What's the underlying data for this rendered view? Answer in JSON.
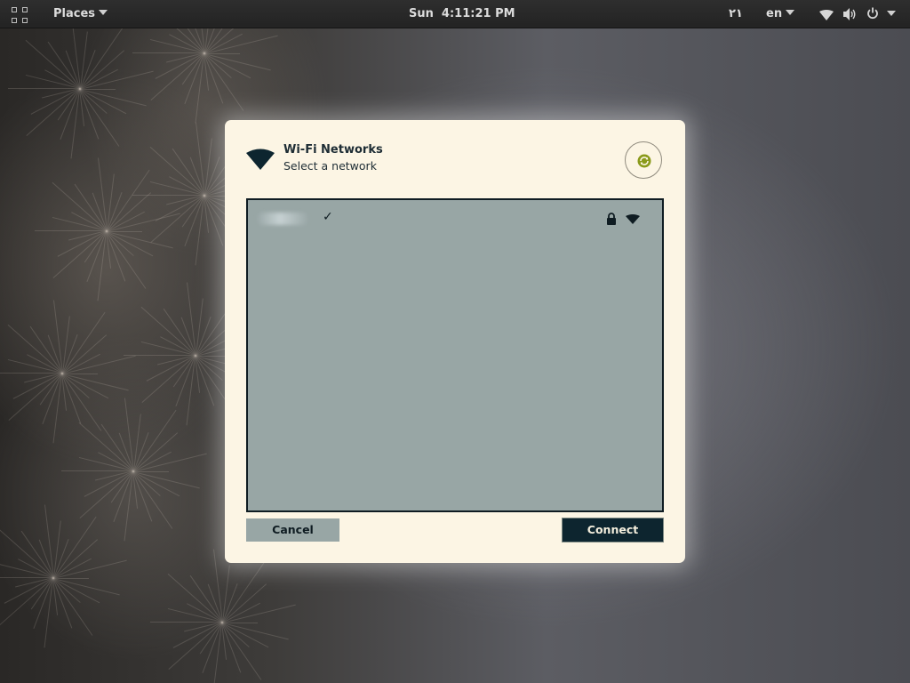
{
  "topbar": {
    "activities_icon": "grid-icon",
    "places_label": "Places",
    "clock": "Sun  4:11:21 PM",
    "arabic_indicator": "٢١",
    "keyboard_layout": "en",
    "tray_icons": [
      "wifi-icon",
      "volume-icon",
      "power-icon",
      "chevron-down-icon"
    ]
  },
  "dialog": {
    "title": "Wi-Fi Networks",
    "subtitle": "Select a network",
    "refresh_icon": "refresh-icon",
    "networks": [
      {
        "name": "",
        "connected": true,
        "check": "✓",
        "secured": true,
        "signal_icon": "wifi-signal-icon"
      }
    ],
    "cancel_label": "Cancel",
    "connect_label": "Connect"
  },
  "colors": {
    "dialog_bg": "#fcf5e4",
    "list_bg": "#98a6a5",
    "accent_dark": "#0d252f",
    "refresh_accent": "#8a9a1a"
  }
}
